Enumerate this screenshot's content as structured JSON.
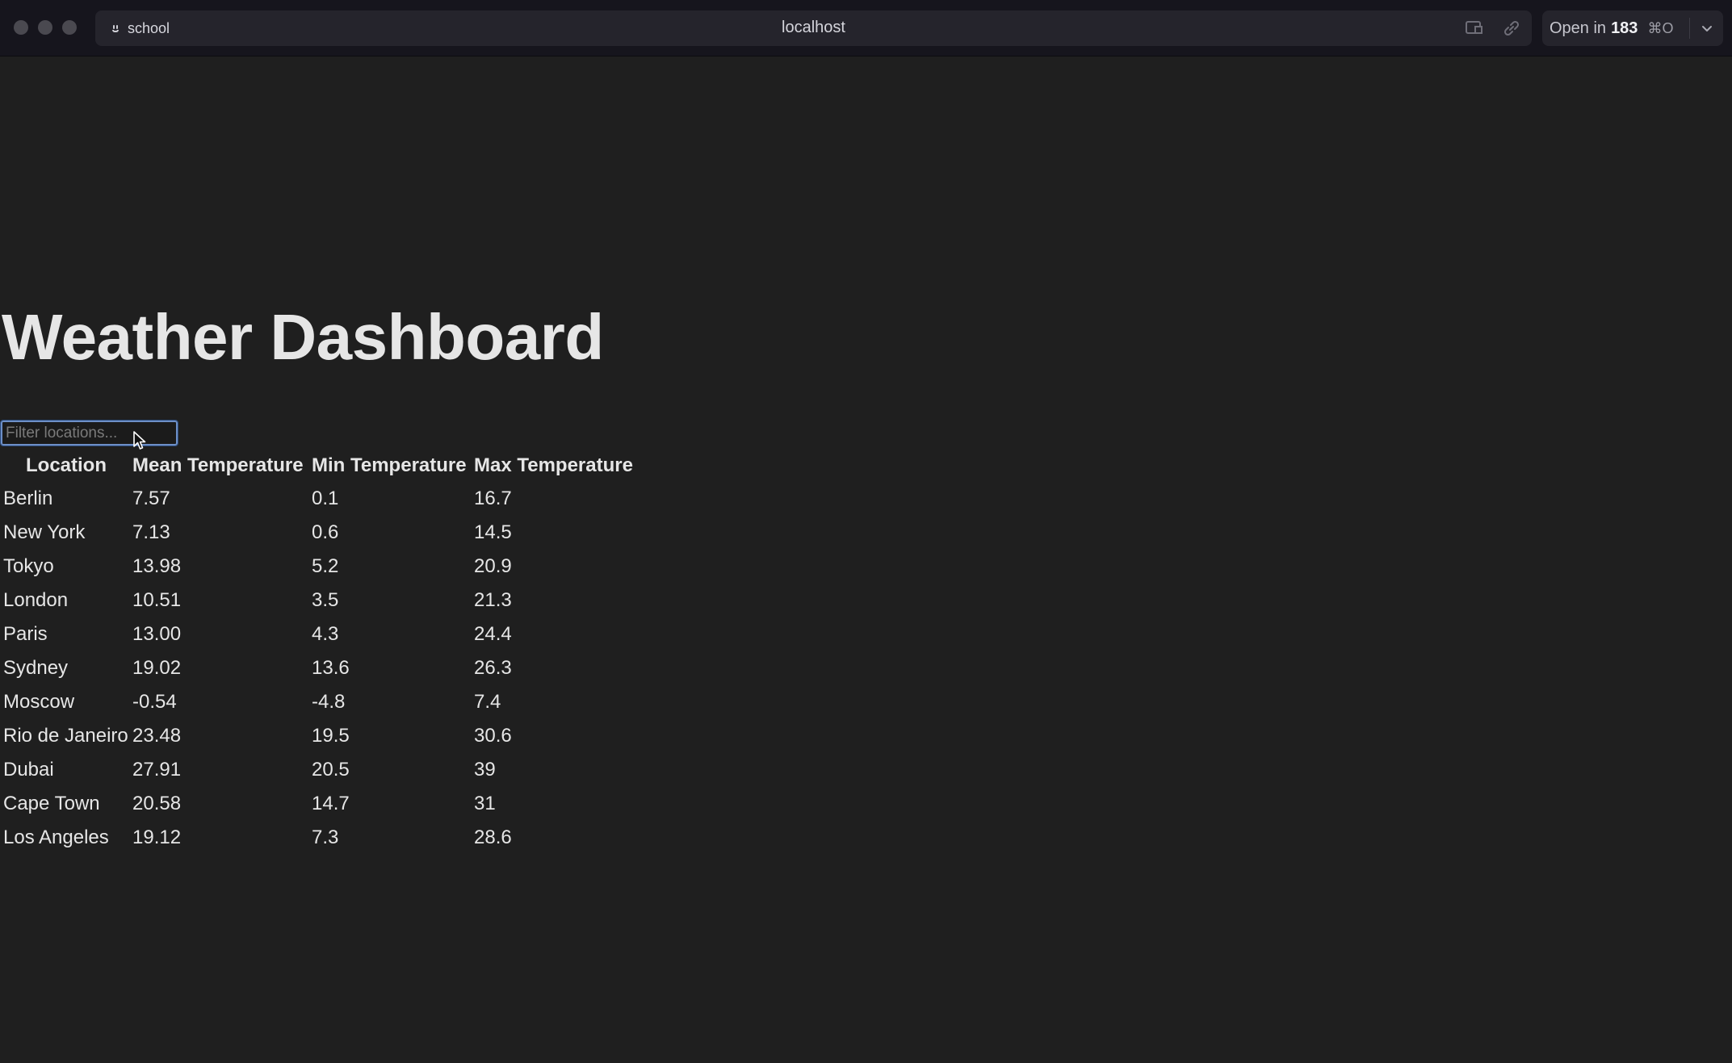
{
  "browser": {
    "tab_name": "school",
    "url": "localhost",
    "open_in": {
      "label": "Open in",
      "count": "183",
      "shortcut": "⌘O"
    }
  },
  "page": {
    "title": "Weather Dashboard",
    "filter": {
      "placeholder": "Filter locations...",
      "value": ""
    },
    "table": {
      "headers": [
        "Location",
        "Mean Temperature",
        "Min Temperature",
        "Max Temperature"
      ],
      "rows": [
        [
          "Berlin",
          "7.57",
          "0.1",
          "16.7"
        ],
        [
          "New York",
          "7.13",
          "0.6",
          "14.5"
        ],
        [
          "Tokyo",
          "13.98",
          "5.2",
          "20.9"
        ],
        [
          "London",
          "10.51",
          "3.5",
          "21.3"
        ],
        [
          "Paris",
          "13.00",
          "4.3",
          "24.4"
        ],
        [
          "Sydney",
          "19.02",
          "13.6",
          "26.3"
        ],
        [
          "Moscow",
          "-0.54",
          "-4.8",
          "7.4"
        ],
        [
          "Rio de Janeiro",
          "23.48",
          "19.5",
          "30.6"
        ],
        [
          "Dubai",
          "27.91",
          "20.5",
          "39"
        ],
        [
          "Cape Town",
          "20.58",
          "14.7",
          "31"
        ],
        [
          "Los Angeles",
          "19.12",
          "7.3",
          "28.6"
        ]
      ]
    }
  },
  "colors": {
    "background": "#1f1f1f",
    "chrome": "#16151d",
    "focus_ring": "#6d8fc7"
  }
}
